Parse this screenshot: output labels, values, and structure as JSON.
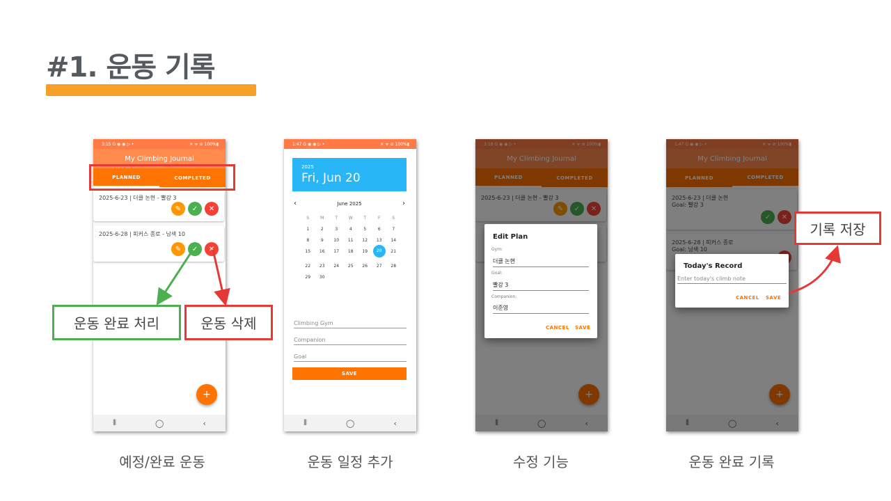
{
  "slide": {
    "title": "#1. 운동 기록",
    "accent_color": "#f7a027"
  },
  "status_bar": {
    "phone1_time": "3:15",
    "phone2_time": "1:47",
    "phone3_time": "3:18",
    "phone4_time": "1:47",
    "icons_left": "G ◉ ◉ ▷ •",
    "icons_right": "✕ ᯤ ⊘ 100%▮"
  },
  "app": {
    "title": "My Climbing Journal",
    "tab_planned": "PLANNED",
    "tab_completed": "COMPLETED",
    "fab_label": "+",
    "theme_color": "#ff7300"
  },
  "phone1": {
    "items": [
      {
        "text": "2025-6-23 | 더클 논현 - 빨강 3"
      },
      {
        "text": "2025-6-28 | 피커스 종로 - 남색 10"
      }
    ]
  },
  "phone2": {
    "year": "2025",
    "date": "Fri, Jun 20",
    "month": "June 2025",
    "weekdays": [
      "S",
      "M",
      "T",
      "W",
      "T",
      "F",
      "S"
    ],
    "selected_day": "20",
    "placeholder_gym": "Climbing Gym",
    "placeholder_companion": "Companion",
    "placeholder_goal": "Goal",
    "save_label": "SAVE"
  },
  "phone3": {
    "bg_item": "2025-6-23 | 더클 논현 - 빨강 3",
    "dialog_title": "Edit Plan",
    "gym_label": "Gym:",
    "gym_value": "더클 논현",
    "goal_label": "Goal:",
    "goal_value": "빨강 3",
    "companion_label": "Companion:",
    "companion_value": "이준영",
    "cancel_label": "CANCEL",
    "save_label": "SAVE"
  },
  "phone4": {
    "item1_line1": "2025-6-23 | 더클 논현",
    "item1_line2": "Goal: 빨강 3",
    "item2_line1": "2025-6-28 | 피커스 종로",
    "item2_line2": "Goal: 남색 10",
    "dialog_title": "Today's Record",
    "placeholder": "Enter today's climb note",
    "cancel_label": "CANCEL",
    "save_label": "SAVE"
  },
  "callouts": {
    "complete": "운동 완료 처리",
    "delete": "운동 삭제",
    "save_record": "기록 저장",
    "green": "#4caf50",
    "red": "#e53935"
  },
  "captions": {
    "c1": "예정/완료 운동",
    "c2": "운동 일정 추가",
    "c3": "수정 기능",
    "c4": "운동 완료 기록"
  }
}
